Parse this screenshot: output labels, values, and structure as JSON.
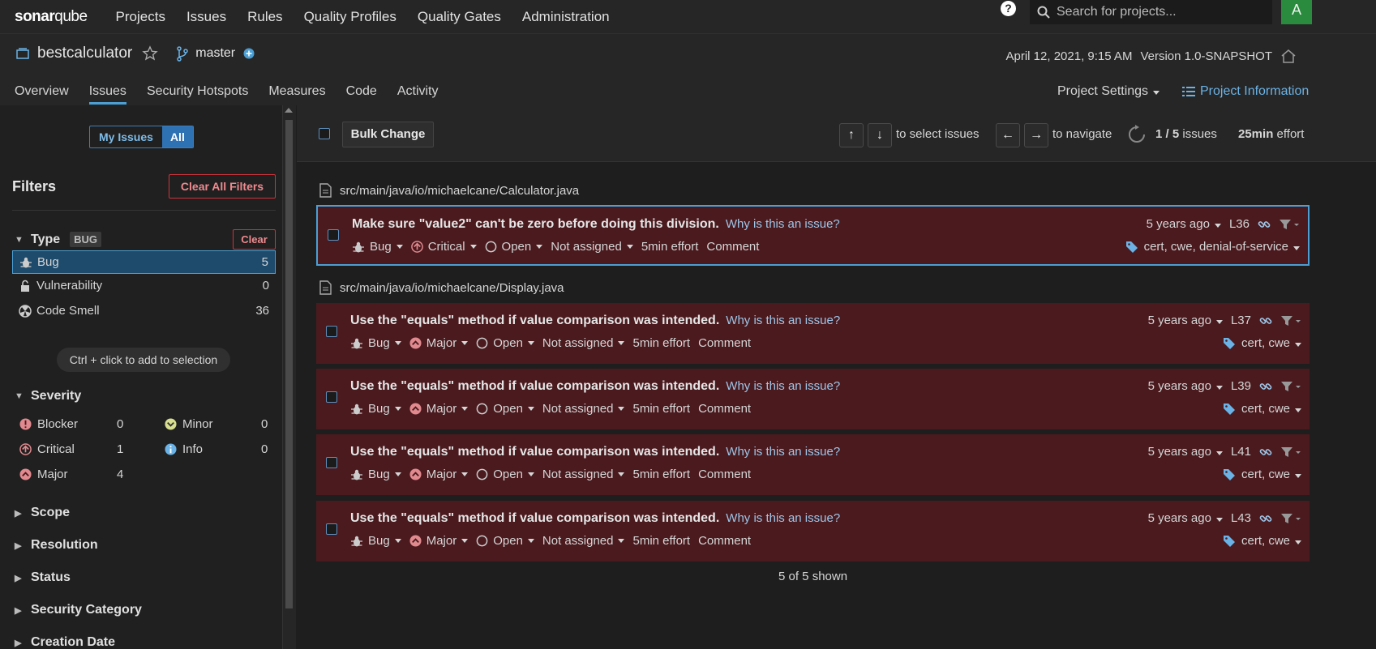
{
  "app": {
    "logo_prefix": "sonar",
    "logo_suffix": "qube",
    "nav": [
      "Projects",
      "Issues",
      "Rules",
      "Quality Profiles",
      "Quality Gates",
      "Administration"
    ],
    "search_placeholder": "Search for projects...",
    "avatar_letter": "A"
  },
  "project": {
    "name": "bestcalculator",
    "branch": "master",
    "date": "April 12, 2021, 9:15 AM",
    "version": "Version 1.0-SNAPSHOT",
    "tabs": [
      "Overview",
      "Issues",
      "Security Hotspots",
      "Measures",
      "Code",
      "Activity"
    ],
    "active_tab": "Issues",
    "settings_label": "Project Settings",
    "info_label": "Project Information"
  },
  "sidebar": {
    "my_issues": "My Issues",
    "all": "All",
    "filters_title": "Filters",
    "clear_all": "Clear All Filters",
    "type": {
      "title": "Type",
      "badge": "BUG",
      "clear": "Clear",
      "items": [
        {
          "label": "Bug",
          "count": "5"
        },
        {
          "label": "Vulnerability",
          "count": "0"
        },
        {
          "label": "Code Smell",
          "count": "36"
        }
      ]
    },
    "hint": "Ctrl + click to add to selection",
    "severity": {
      "title": "Severity",
      "items": [
        {
          "label": "Blocker",
          "count": "0"
        },
        {
          "label": "Minor",
          "count": "0"
        },
        {
          "label": "Critical",
          "count": "1"
        },
        {
          "label": "Info",
          "count": "0"
        },
        {
          "label": "Major",
          "count": "4"
        }
      ]
    },
    "collapsed_facets": [
      "Scope",
      "Resolution",
      "Status",
      "Security Category",
      "Creation Date"
    ]
  },
  "toolbar": {
    "bulk_change": "Bulk Change",
    "up_key": "↑",
    "down_key": "↓",
    "select_text": "to select issues",
    "left_key": "←",
    "right_key": "→",
    "navigate_text": "to navigate",
    "paging": "1 / 5",
    "issues_word": "issues",
    "effort": "25min",
    "effort_word": "effort"
  },
  "files": [
    "src/main/java/io/michaelcane/Calculator.java",
    "src/main/java/io/michaelcane/Display.java"
  ],
  "issues": [
    {
      "message": "Make sure \"value2\" can't be zero before doing this division.",
      "why": "Why is this an issue?",
      "type": "Bug",
      "severity": "Critical",
      "status": "Open",
      "assignee": "Not assigned",
      "effort": "5min effort",
      "comment": "Comment",
      "age": "5 years ago",
      "line": "L36",
      "tags": "cert, cwe, denial-of-service"
    },
    {
      "message": "Use the \"equals\" method if value comparison was intended.",
      "why": "Why is this an issue?",
      "type": "Bug",
      "severity": "Major",
      "status": "Open",
      "assignee": "Not assigned",
      "effort": "5min effort",
      "comment": "Comment",
      "age": "5 years ago",
      "line": "L37",
      "tags": "cert, cwe"
    },
    {
      "message": "Use the \"equals\" method if value comparison was intended.",
      "why": "Why is this an issue?",
      "type": "Bug",
      "severity": "Major",
      "status": "Open",
      "assignee": "Not assigned",
      "effort": "5min effort",
      "comment": "Comment",
      "age": "5 years ago",
      "line": "L39",
      "tags": "cert, cwe"
    },
    {
      "message": "Use the \"equals\" method if value comparison was intended.",
      "why": "Why is this an issue?",
      "type": "Bug",
      "severity": "Major",
      "status": "Open",
      "assignee": "Not assigned",
      "effort": "5min effort",
      "comment": "Comment",
      "age": "5 years ago",
      "line": "L41",
      "tags": "cert, cwe"
    },
    {
      "message": "Use the \"equals\" method if value comparison was intended.",
      "why": "Why is this an issue?",
      "type": "Bug",
      "severity": "Major",
      "status": "Open",
      "assignee": "Not assigned",
      "effort": "5min effort",
      "comment": "Comment",
      "age": "5 years ago",
      "line": "L43",
      "tags": "cert, cwe"
    }
  ],
  "footer": {
    "shown": "5 of 5 shown"
  },
  "colors": {
    "issue_bg": "#4a1a1e",
    "accent": "#4b9fd5",
    "danger": "#d0333c"
  }
}
